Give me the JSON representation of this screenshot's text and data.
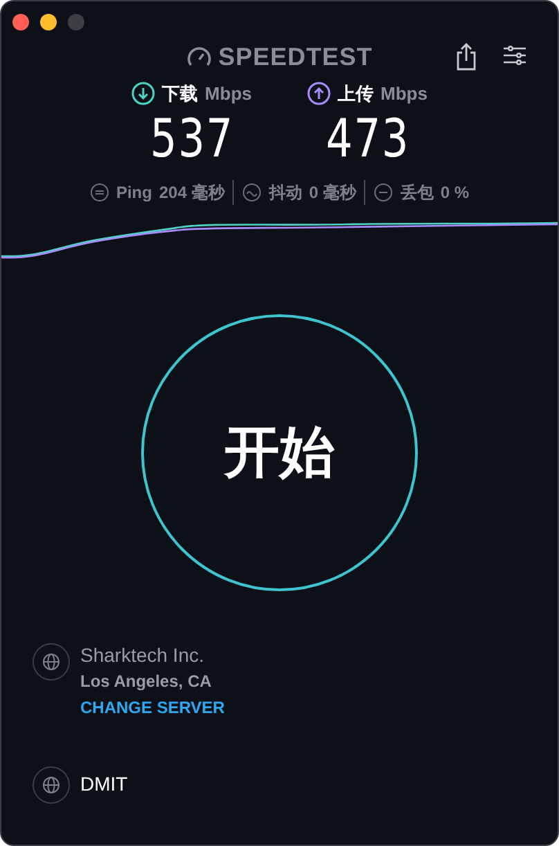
{
  "app": {
    "title": "SPEEDTEST"
  },
  "speeds": [
    {
      "kind": "download",
      "label": "下载",
      "unit": "Mbps",
      "value": "537"
    },
    {
      "kind": "upload",
      "label": "上传",
      "unit": "Mbps",
      "value": "473"
    }
  ],
  "stats": [
    {
      "kind": "ping",
      "label": "Ping",
      "value": "204 毫秒"
    },
    {
      "kind": "jitter",
      "label": "抖动",
      "value": "0 毫秒"
    },
    {
      "kind": "loss",
      "label": "丢包",
      "value": "0 %"
    }
  ],
  "start_button": {
    "label": "开始"
  },
  "server": {
    "name": "Sharktech Inc.",
    "location": "Los Angeles, CA",
    "action": "CHANGE SERVER"
  },
  "provider": {
    "name": "DMIT"
  }
}
